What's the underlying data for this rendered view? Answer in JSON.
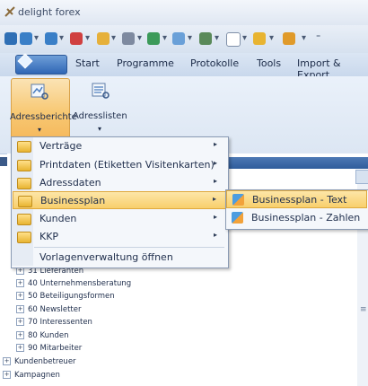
{
  "window": {
    "title": "delight forex"
  },
  "ribbon": {
    "tabs": [
      "Start",
      "Programme",
      "Protokolle",
      "Tools",
      "Import & Export"
    ],
    "buttons": {
      "adressberichte": "Adressberichte",
      "adresslisten": "Adresslisten"
    }
  },
  "menu": {
    "items": [
      {
        "label": "Verträge",
        "has_submenu": true
      },
      {
        "label": "Printdaten (Etiketten Visitenkarten)",
        "has_submenu": true
      },
      {
        "label": "Adressdaten",
        "has_submenu": true
      },
      {
        "label": "Businessplan",
        "has_submenu": true,
        "active": true
      },
      {
        "label": "Kunden",
        "has_submenu": true
      },
      {
        "label": "KKP",
        "has_submenu": true
      }
    ],
    "footer": "Vorlagenverwaltung öffnen",
    "submenu_glyph": "▸"
  },
  "submenu": {
    "items": [
      {
        "label": "Businessplan - Text",
        "active": true
      },
      {
        "label": "Businessplan - Zahlen"
      }
    ]
  },
  "tree": {
    "expand_glyph": "+",
    "items": [
      "31 Lieferanten",
      "40 Unternehmensberatung",
      "50 Beteiligungsformen",
      "60 Newsletter",
      "70 Interessenten",
      "80 Kunden",
      "90 Mitarbeiter",
      "Kundenbetreuer",
      "Kampagnen"
    ]
  },
  "colors": {
    "highlight": "#f8cf6c",
    "ribbon_blue": "#2f66b5",
    "folder": "#e8b431"
  },
  "icons": {
    "logo": "delight-logo-icon",
    "folder": "folder-icon",
    "report": "report-icon",
    "document": "document-icon"
  }
}
